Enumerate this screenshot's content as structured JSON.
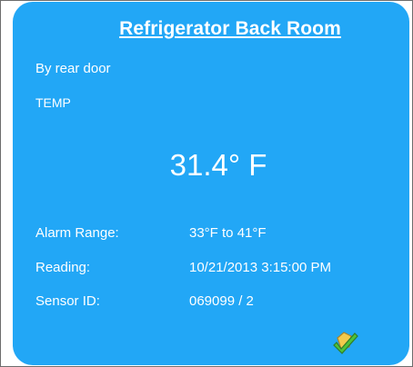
{
  "card": {
    "title": "Refrigerator Back Room",
    "location": "By rear door",
    "type": "TEMP",
    "reading": "31.4° F",
    "details": {
      "alarm_range_label": "Alarm Range:",
      "alarm_range_value": "33°F to 41°F",
      "reading_label": "Reading:",
      "reading_value": "10/21/2013 3:15:00 PM",
      "sensor_id_label": "Sensor ID:",
      "sensor_id_value": "069099 / 2"
    },
    "status_icon": "checkmark-shield-icon"
  },
  "colors": {
    "card_background": "#22a7f6",
    "text": "#ffffff",
    "check_green": "#4cc23a",
    "icon_yellow": "#f2c94c"
  }
}
